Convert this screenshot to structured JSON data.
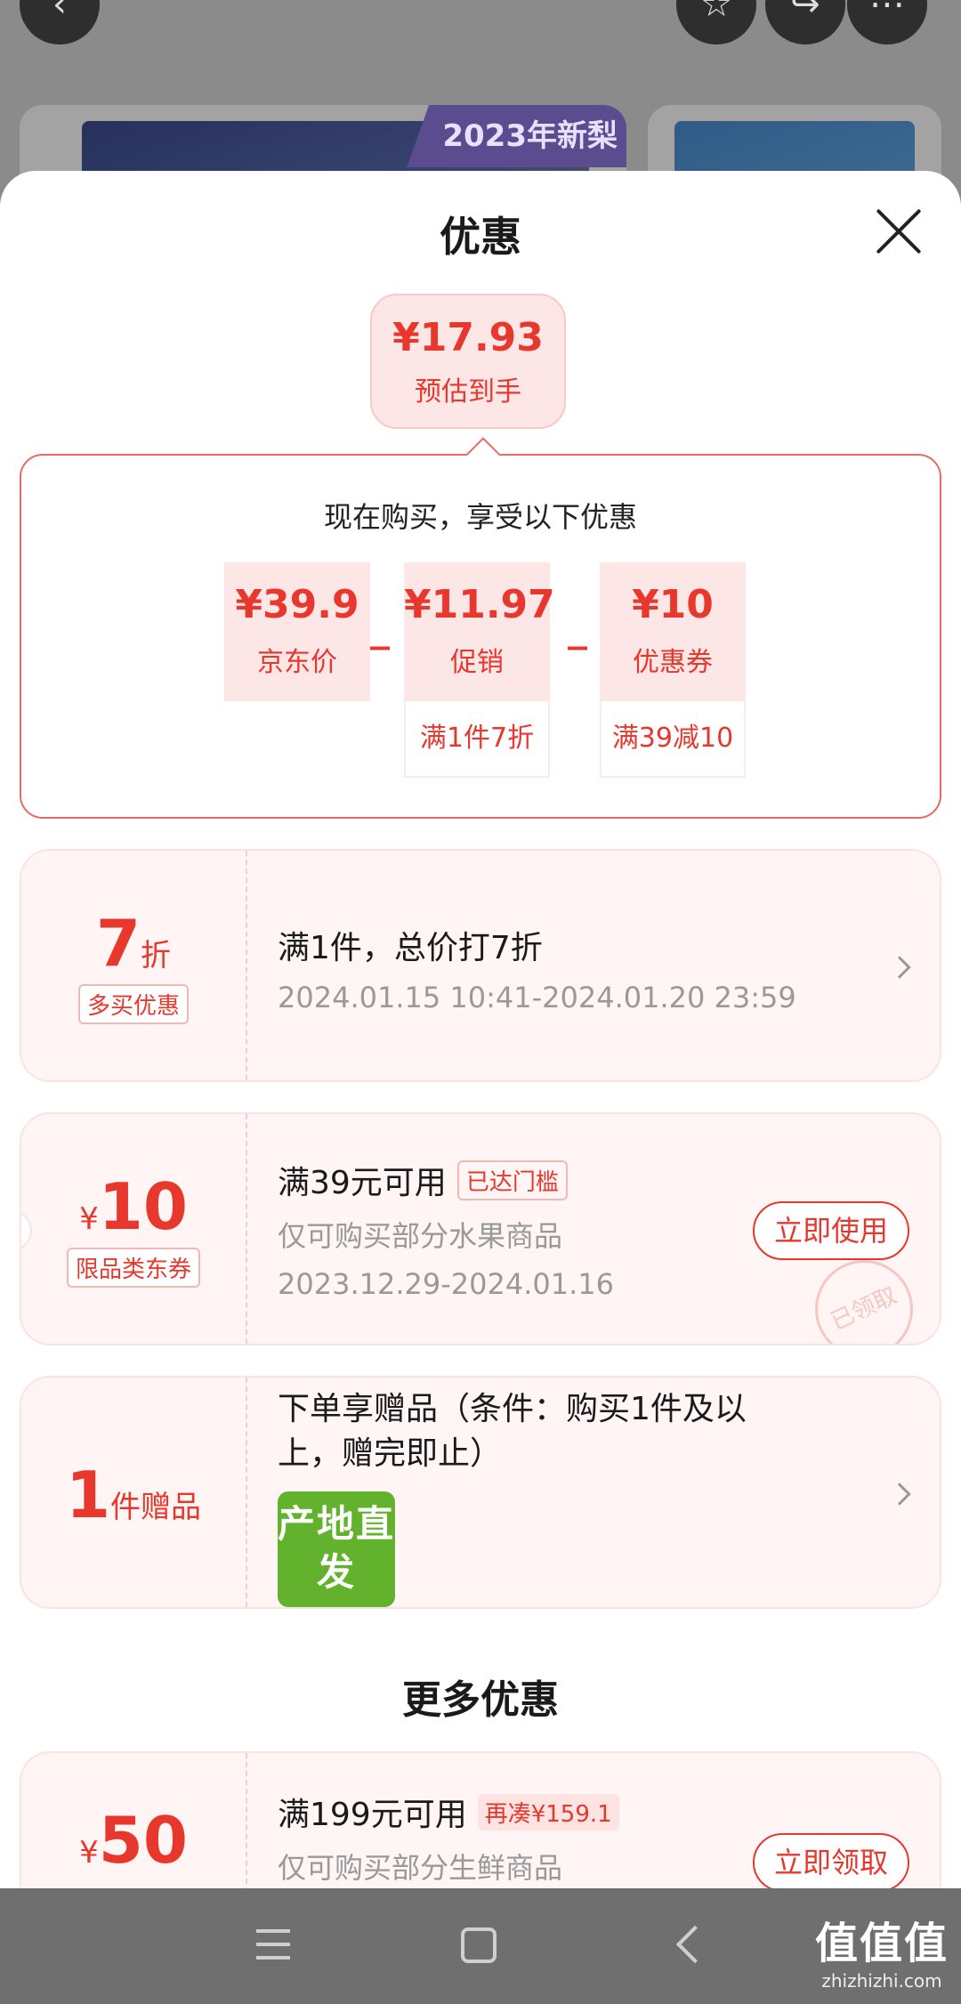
{
  "background": {
    "banner_text": "2023年新梨"
  },
  "sheet": {
    "title": "优惠"
  },
  "estimate": {
    "price": "¥17.93",
    "label": "预估到手"
  },
  "breakdown": {
    "title": "现在购买，享受以下优惠",
    "items": [
      {
        "value": "¥39.9",
        "label": "京东价",
        "sub": ""
      },
      {
        "value": "¥11.97",
        "label": "促销",
        "sub": "满1件7折"
      },
      {
        "value": "¥10",
        "label": "优惠券",
        "sub": "满39减10"
      }
    ],
    "operator": "_"
  },
  "offers": [
    {
      "big": "7",
      "unit": "折",
      "tag": "多买优惠",
      "title": "满1件，总价打7折",
      "lines": [
        "2024.01.15 10:41-2024.01.20 23:59"
      ]
    },
    {
      "prefix": "¥",
      "big": "10",
      "tag": "限品类东券",
      "title": "满39元可用",
      "badge": "已达门槛",
      "lines": [
        "仅可购买部分水果商品",
        "2023.12.29-2024.01.16"
      ],
      "action": "立即使用",
      "stamp": "已领取"
    },
    {
      "big": "1",
      "unit": "件赠品",
      "title_line1": "下单享赠品（条件：购买1件及以",
      "title_line2": "上，赠完即止）",
      "logo": "产地直发"
    }
  ],
  "more": {
    "title": "更多优惠",
    "coupon": {
      "prefix": "¥",
      "big": "50",
      "title": "满199元可用",
      "badge": "再凑¥159.1",
      "line": "仅可购买部分生鲜商品",
      "action": "立即领取"
    }
  },
  "watermark": {
    "big": "值值值",
    "small": "zhizhizhi.com"
  }
}
